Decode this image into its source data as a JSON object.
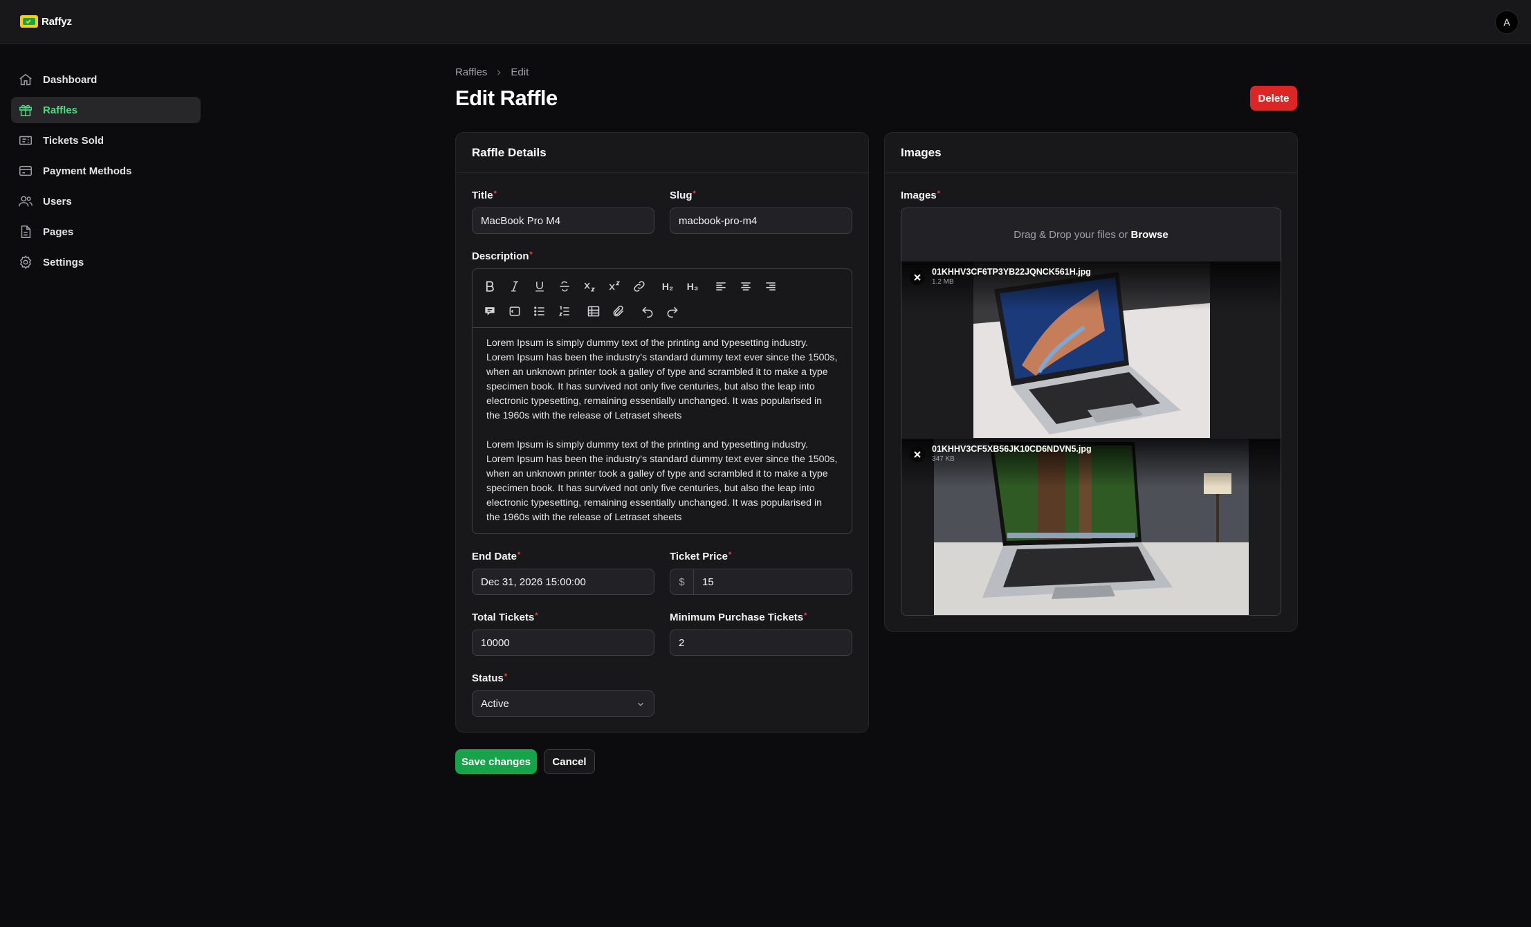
{
  "app": {
    "name": "Raffyz",
    "avatar_initial": "A"
  },
  "sidebar": {
    "items": [
      {
        "label": "Dashboard",
        "icon": "home-icon"
      },
      {
        "label": "Raffles",
        "icon": "gift-icon",
        "active": true
      },
      {
        "label": "Tickets Sold",
        "icon": "ticket-icon"
      },
      {
        "label": "Payment Methods",
        "icon": "credit-card-icon"
      },
      {
        "label": "Users",
        "icon": "users-icon"
      },
      {
        "label": "Pages",
        "icon": "document-icon"
      },
      {
        "label": "Settings",
        "icon": "gear-icon"
      }
    ]
  },
  "breadcrumb": {
    "parent": "Raffles",
    "current": "Edit"
  },
  "page": {
    "title": "Edit Raffle",
    "delete_label": "Delete"
  },
  "details": {
    "heading": "Raffle Details",
    "title_label": "Title",
    "title_value": "MacBook Pro M4",
    "slug_label": "Slug",
    "slug_value": "macbook-pro-m4",
    "description_label": "Description",
    "description_paragraphs": [
      "Lorem Ipsum is simply dummy text of the printing and typesetting industry. Lorem Ipsum has been the industry's standard dummy text ever since the 1500s, when an unknown printer took a galley of type and scrambled it to make a type specimen book. It has survived not only five centuries, but also the leap into electronic typesetting, remaining essentially unchanged. It was popularised in the 1960s with the release of Letraset sheets",
      "Lorem Ipsum is simply dummy text of the printing and typesetting industry. Lorem Ipsum has been the industry's standard dummy text ever since the 1500s, when an unknown printer took a galley of type and scrambled it to make a type specimen book. It has survived not only five centuries, but also the leap into electronic typesetting, remaining essentially unchanged. It was popularised in the 1960s with the release of Letraset sheets"
    ],
    "toolbar": {
      "h2": "H₂",
      "h3": "H₃"
    },
    "end_date_label": "End Date",
    "end_date_value": "Dec 31, 2026 15:00:00",
    "ticket_price_label": "Ticket Price",
    "ticket_price_prefix": "$",
    "ticket_price_value": "15",
    "total_tickets_label": "Total Tickets",
    "total_tickets_value": "10000",
    "min_purchase_label": "Minimum Purchase Tickets",
    "min_purchase_value": "2",
    "status_label": "Status",
    "status_value": "Active"
  },
  "images": {
    "heading": "Images",
    "field_label": "Images",
    "drop_text": "Drag & Drop your files or",
    "browse_label": "Browse",
    "files": [
      {
        "name": "01KHHV3CF6TP3YB22JQNCK561H.jpg",
        "size": "1.2 MB"
      },
      {
        "name": "01KHHV3CF5XB56JK10CD6NDVN5.jpg",
        "size": "347 KB"
      }
    ]
  },
  "actions": {
    "save_label": "Save changes",
    "cancel_label": "Cancel"
  },
  "colors": {
    "accent": "#4ade80",
    "danger": "#dc2626",
    "primary": "#16a34a",
    "background": "#0c0c0e"
  }
}
